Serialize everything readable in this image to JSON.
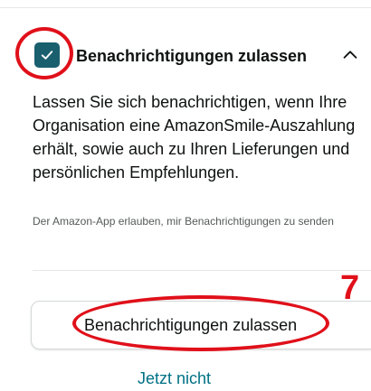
{
  "permission": {
    "title": "Benachrichtigungen zulassen",
    "checked": true,
    "description": "Lassen Sie sich benachrichtigen, wenn Ihre Organisation eine AmazonSmile-Auszahlung erhält, sowie auch zu Ihren Lieferungen und persönlichen Empfehlungen.",
    "subtext": "Der Amazon-App erlauben, mir Benachrichtigungen zu senden"
  },
  "actions": {
    "allow_label": "Benachrichtigungen zulassen",
    "not_now_label": "Jetzt nicht"
  },
  "annotation": {
    "step": "7"
  },
  "colors": {
    "checkbox": "#1a5f6e",
    "annotation": "#e0101a",
    "link": "#007185",
    "text": "#0f1111",
    "subtext": "#565959"
  },
  "icons": {
    "checkbox": "check-icon",
    "toggle": "chevron-up-icon"
  }
}
